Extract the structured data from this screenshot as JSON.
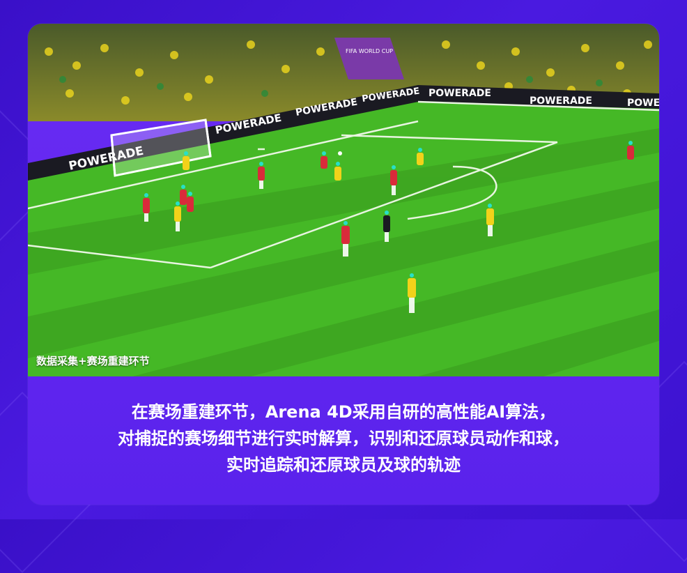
{
  "photo": {
    "caption": "数据采集+赛场重建环节",
    "ad_boards": [
      "POWERADE",
      "POWERADE",
      "POWERADE",
      "POWERADE",
      "POWERADE",
      "POWERADE",
      "POWERADE"
    ],
    "banner": "FIFA WORLD CUP"
  },
  "description": {
    "line1": "在赛场重建环节，Arena 4D采用自研的高性能AI算法，",
    "line2": "对捕捉的赛场细节进行实时解算，识别和还原球员动作和球，",
    "line3": "实时追踪和还原球员及球的轨迹"
  },
  "colors": {
    "background": "#4218d8",
    "card": "#5f25ee",
    "pitch_light": "#4cbf2a",
    "pitch_dark": "#3aa51f",
    "team_red": "#d92b3a",
    "team_yellow": "#f2d21a"
  }
}
